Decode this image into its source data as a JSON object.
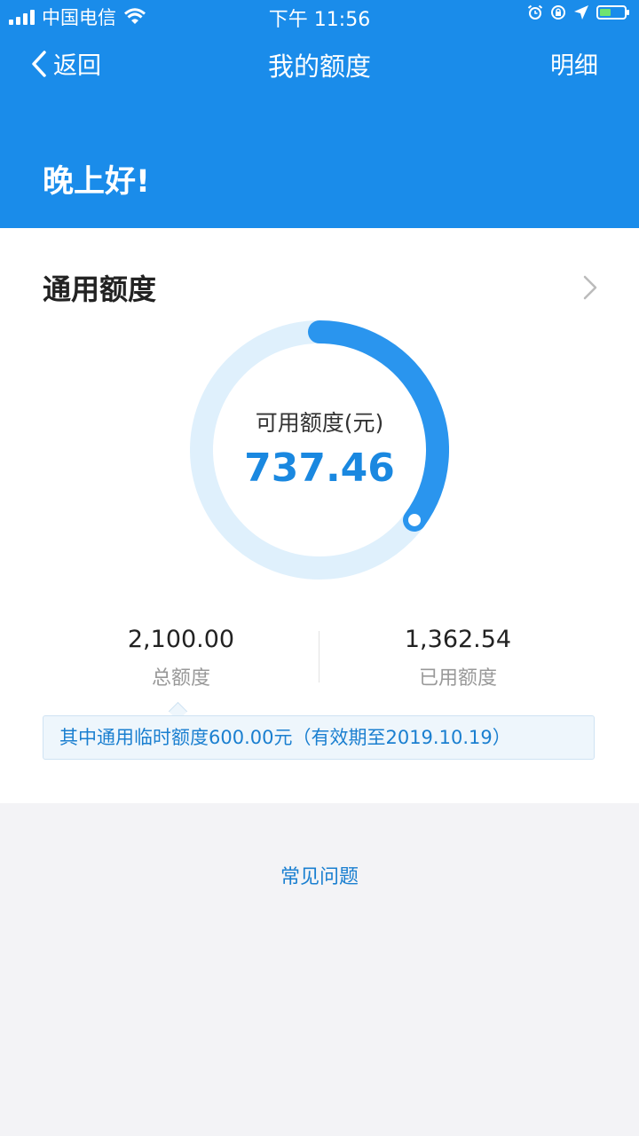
{
  "status_bar": {
    "carrier": "中国电信",
    "time": "下午 11:56"
  },
  "nav": {
    "back_label": "返回",
    "title": "我的额度",
    "detail_label": "明细"
  },
  "greeting": "晚上好!",
  "card": {
    "title": "通用额度",
    "gauge": {
      "label": "可用额度(元)",
      "value": "737.46",
      "available_fraction": 0.3512
    },
    "stats": [
      {
        "value": "2,100.00",
        "label": "总额度"
      },
      {
        "value": "1,362.54",
        "label": "已用额度"
      }
    ],
    "note": "其中通用临时额度600.00元（有效期至2019.10.19）"
  },
  "faq_label": "常见问题",
  "colors": {
    "primary": "#1a8cea",
    "gauge_track": "#dff0fc",
    "gauge_fill": "#2a95ee",
    "value_text": "#1a88e0",
    "page_bg": "#f3f3f6"
  }
}
